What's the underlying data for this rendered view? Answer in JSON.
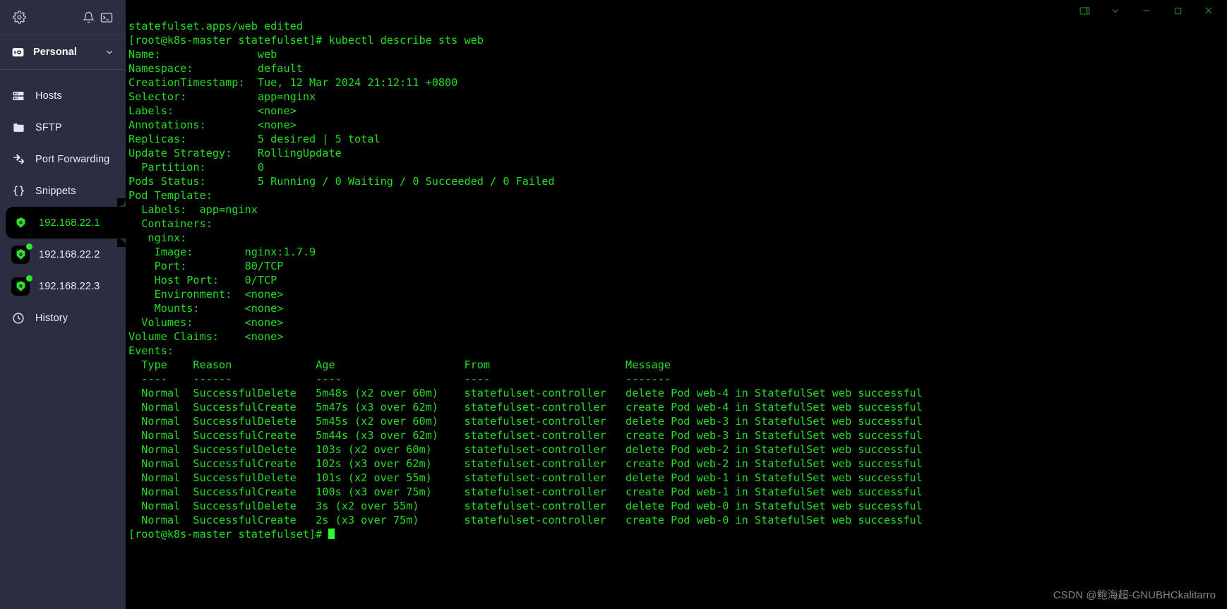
{
  "window": {
    "controls": [
      {
        "name": "panel-toggle",
        "glyph": "panel"
      },
      {
        "name": "chevron-down",
        "glyph": "chevron"
      },
      {
        "name": "minimize",
        "glyph": "minimize"
      },
      {
        "name": "maximize",
        "glyph": "maximize"
      },
      {
        "name": "close",
        "glyph": "close"
      }
    ],
    "control_color": "#1f7a1f"
  },
  "sidebar": {
    "background": "#2a2e40",
    "top_icons": [
      {
        "name": "settings-icon",
        "label": "Settings"
      },
      {
        "name": "notifications-icon",
        "label": "Notifications"
      },
      {
        "name": "terminal-icon",
        "label": "Terminal"
      }
    ],
    "account": {
      "label": "Personal",
      "icon": "vault-icon",
      "chevron": "chevron-down-icon"
    },
    "nav_items": [
      {
        "label": "Hosts",
        "icon": "server-icon"
      },
      {
        "label": "SFTP",
        "icon": "folder-icon"
      },
      {
        "label": "Port Forwarding",
        "icon": "arrows-icon"
      },
      {
        "label": "Snippets",
        "icon": "braces-icon"
      }
    ],
    "hosts": [
      {
        "label": "192.168.22.1",
        "active": true,
        "online": false
      },
      {
        "label": "192.168.22.2",
        "active": false,
        "online": true
      },
      {
        "label": "192.168.22.3",
        "active": false,
        "online": true
      }
    ],
    "history": {
      "label": "History",
      "icon": "clock-icon"
    },
    "active_color": "#2fe02f",
    "text_color": "#eceef4"
  },
  "terminal": {
    "fg_color": "#24dd24",
    "bg_color": "#000000",
    "lines": [
      "statefulset.apps/web edited",
      "[root@k8s-master statefulset]# kubectl describe sts web",
      "Name:               web",
      "Namespace:          default",
      "CreationTimestamp:  Tue, 12 Mar 2024 21:12:11 +0800",
      "Selector:           app=nginx",
      "Labels:             <none>",
      "Annotations:        <none>",
      "Replicas:           5 desired | 5 total",
      "Update Strategy:    RollingUpdate",
      "  Partition:        0",
      "Pods Status:        5 Running / 0 Waiting / 0 Succeeded / 0 Failed",
      "Pod Template:",
      "  Labels:  app=nginx",
      "  Containers:",
      "   nginx:",
      "    Image:        nginx:1.7.9",
      "    Port:         80/TCP",
      "    Host Port:    0/TCP",
      "    Environment:  <none>",
      "    Mounts:       <none>",
      "  Volumes:        <none>",
      "Volume Claims:    <none>",
      "Events:",
      "  Type    Reason             Age                    From                     Message",
      "  ----    ------             ----                   ----                     -------",
      "  Normal  SuccessfulDelete   5m48s (x2 over 60m)    statefulset-controller   delete Pod web-4 in StatefulSet web successful",
      "  Normal  SuccessfulCreate   5m47s (x3 over 62m)    statefulset-controller   create Pod web-4 in StatefulSet web successful",
      "  Normal  SuccessfulDelete   5m45s (x2 over 60m)    statefulset-controller   delete Pod web-3 in StatefulSet web successful",
      "  Normal  SuccessfulCreate   5m44s (x3 over 62m)    statefulset-controller   create Pod web-3 in StatefulSet web successful",
      "  Normal  SuccessfulDelete   103s (x2 over 60m)     statefulset-controller   delete Pod web-2 in StatefulSet web successful",
      "  Normal  SuccessfulCreate   102s (x3 over 62m)     statefulset-controller   create Pod web-2 in StatefulSet web successful",
      "  Normal  SuccessfulDelete   101s (x2 over 55m)     statefulset-controller   delete Pod web-1 in StatefulSet web successful",
      "  Normal  SuccessfulCreate   100s (x3 over 75m)     statefulset-controller   create Pod web-1 in StatefulSet web successful",
      "  Normal  SuccessfulDelete   3s (x2 over 55m)       statefulset-controller   delete Pod web-0 in StatefulSet web successful",
      "  Normal  SuccessfulCreate   2s (x3 over 75m)       statefulset-controller   create Pod web-0 in StatefulSet web successful"
    ],
    "prompt": "[root@k8s-master statefulset]# "
  },
  "watermark": "CSDN @鲍海超-GNUBHCkalitarro"
}
